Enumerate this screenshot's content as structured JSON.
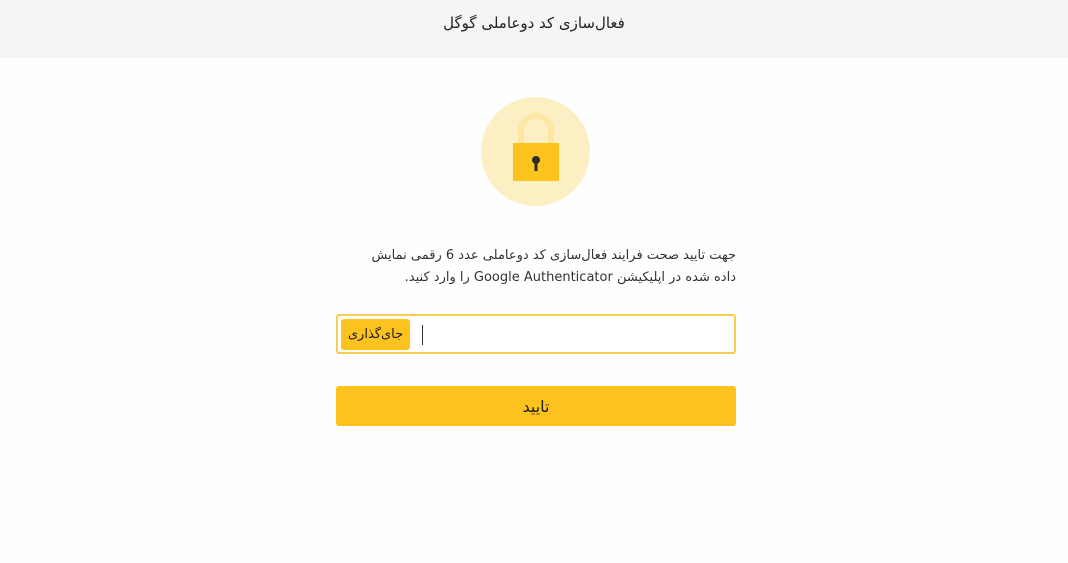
{
  "header": {
    "title": "فعال‌سازی کد دوعاملی گوگل"
  },
  "lock_icon": {
    "name": "lock-icon",
    "circle_color": "#fdefc4",
    "body_color": "#fcc31f",
    "shackle_color": "#fde6a1",
    "keyhole_color": "#2b2b2b"
  },
  "description": {
    "line1": "جهت تایید صحت فرایند فعال‌سازی کد دوعاملی عدد 6 رقمی نمایش",
    "line2": "داده شده در اپلیکیشن Google Authenticator را وارد کنید."
  },
  "code_input": {
    "value": "",
    "placeholder": ""
  },
  "paste_button": {
    "label": "جای‌گذاری"
  },
  "submit_button": {
    "label": "تایید"
  },
  "colors": {
    "accent": "#fcc31f",
    "input_border": "#f7cd52",
    "header_bg": "#f5f5f5"
  }
}
